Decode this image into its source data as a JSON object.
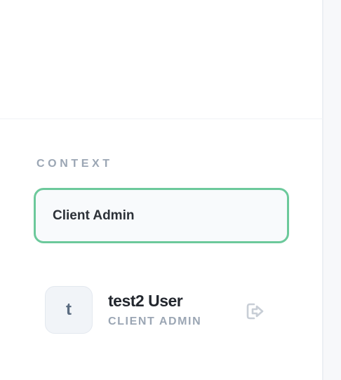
{
  "context": {
    "label": "CONTEXT",
    "selected_value": "Client Admin"
  },
  "user": {
    "avatar_initial": "t",
    "name": "test2 User",
    "role": "CLIENT ADMIN"
  },
  "icons": {
    "logout": "logout-icon"
  },
  "colors": {
    "select_border": "#6cc99b",
    "muted_text": "#9ba6b4",
    "primary_text": "#23272e",
    "icon": "#c8ced6"
  }
}
